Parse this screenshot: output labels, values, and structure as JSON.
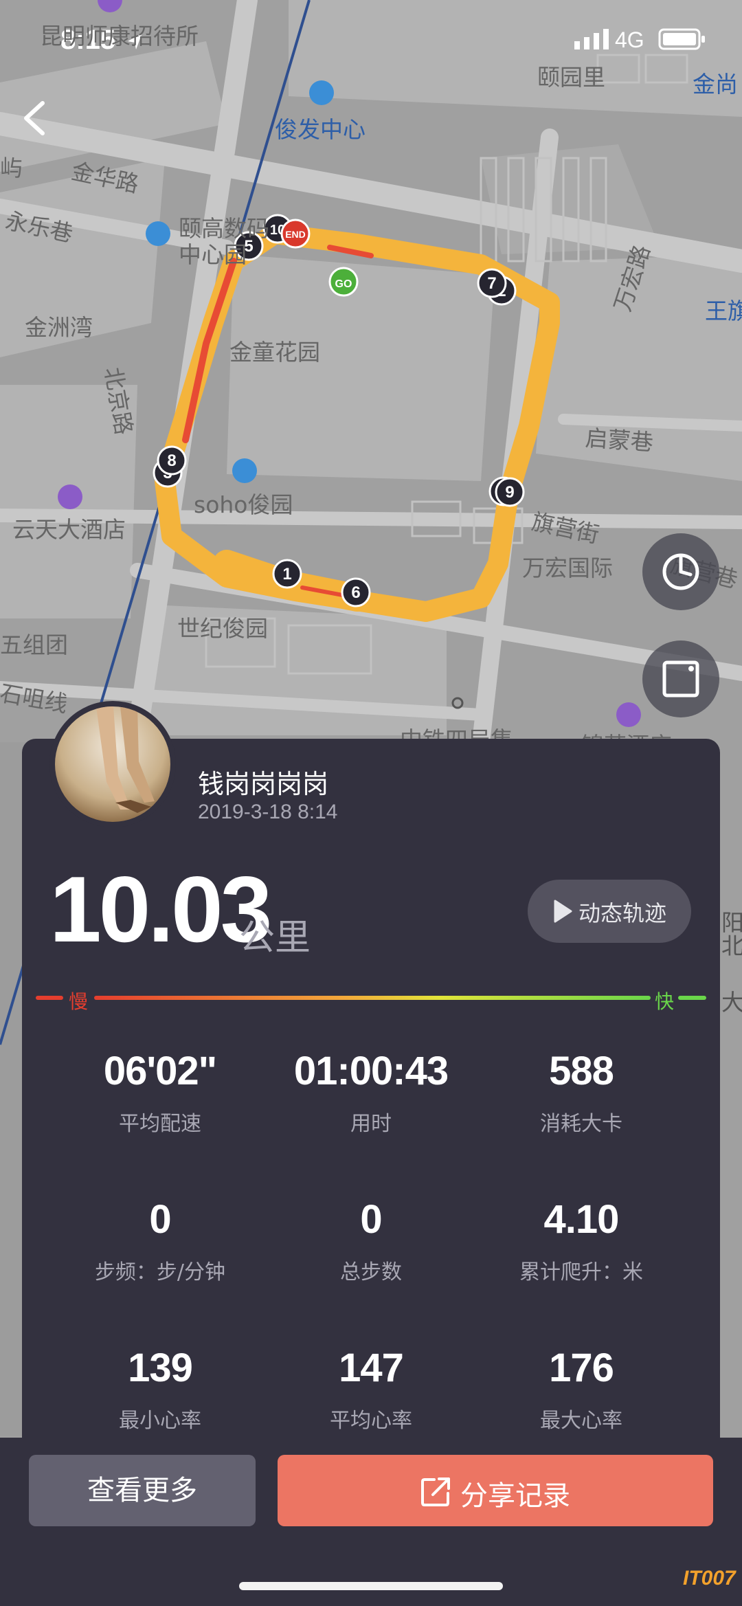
{
  "status_bar": {
    "time": "8:15",
    "network": "4G"
  },
  "map": {
    "labels": [
      {
        "text": "昆明师康招待所"
      },
      {
        "text": "颐园里"
      },
      {
        "text": "金尚"
      },
      {
        "text": "俊发中心"
      },
      {
        "text": "屿"
      },
      {
        "text": "金华路"
      },
      {
        "text": "永乐巷"
      },
      {
        "text": "颐高数码"
      },
      {
        "text": "中心园"
      },
      {
        "text": "万宏路"
      },
      {
        "text": "王旗"
      },
      {
        "text": "金洲湾"
      },
      {
        "text": "金童花园"
      },
      {
        "text": "北京路"
      },
      {
        "text": "启蒙巷"
      },
      {
        "text": "soho俊园"
      },
      {
        "text": "云天大酒店"
      },
      {
        "text": "旗营街"
      },
      {
        "text": "万宏国际"
      },
      {
        "text": "旗营巷"
      },
      {
        "text": "世纪俊园"
      },
      {
        "text": "五组团"
      },
      {
        "text": "石咀线"
      },
      {
        "text": "中铁四局集"
      },
      {
        "text": "锦苑酒店"
      }
    ],
    "markers": {
      "start": "GO",
      "end": "END",
      "km": [
        "1",
        "2",
        "3",
        "4",
        "5",
        "6",
        "7",
        "8",
        "9",
        "10"
      ]
    }
  },
  "user": {
    "name": "钱岗岗岗岗",
    "date": "2019-3-18 8:14"
  },
  "distance": {
    "value": "10.03",
    "unit": "公里"
  },
  "replay": {
    "label": "动态轨迹"
  },
  "speed_legend": {
    "slow": "慢",
    "fast": "快"
  },
  "stats": [
    {
      "value": "06'02\"",
      "label": "平均配速"
    },
    {
      "value": "01:00:43",
      "label": "用时"
    },
    {
      "value": "588",
      "label": "消耗大卡"
    },
    {
      "value": "0",
      "label": "步频：步/分钟"
    },
    {
      "value": "0",
      "label": "总步数"
    },
    {
      "value": "4.10",
      "label": "累计爬升：米"
    },
    {
      "value": "139",
      "label": "最小心率"
    },
    {
      "value": "147",
      "label": "平均心率"
    },
    {
      "value": "176",
      "label": "最大心率"
    }
  ],
  "buttons": {
    "more": "查看更多",
    "share": "分享记录"
  },
  "right_peek": [
    "阳东",
    "北",
    "大"
  ],
  "watermark": "IT007"
}
